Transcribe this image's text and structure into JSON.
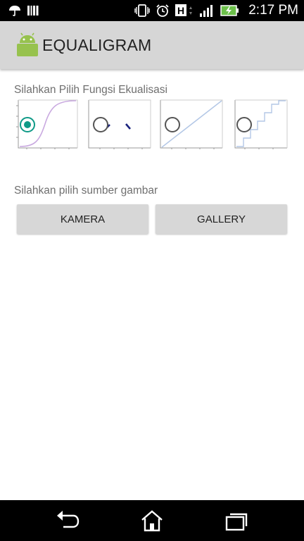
{
  "status_bar": {
    "time": "2:17 PM",
    "icons": [
      "umbrella-icon",
      "barcode-icon",
      "vibrate-icon",
      "alarm-icon",
      "h-signal-icon",
      "signal-bars-icon",
      "battery-charging-icon"
    ],
    "h_label": "H"
  },
  "action_bar": {
    "title": "EQUALIGRAM",
    "icon": "android-icon"
  },
  "content": {
    "function_label": "Silahkan Pilih Fungsi Ekualisasi",
    "function_options": [
      {
        "graph": "sigmoid-curve",
        "selected": true
      },
      {
        "graph": "scatter-points",
        "selected": false
      },
      {
        "graph": "linear-line",
        "selected": false
      },
      {
        "graph": "step-function",
        "selected": false
      }
    ],
    "source_label": "Silahkan pilih sumber gambar",
    "camera_button": "KAMERA",
    "gallery_button": "GALLERY"
  },
  "nav_bar": {
    "buttons": [
      "back-icon",
      "home-icon",
      "recent-apps-icon"
    ]
  },
  "colors": {
    "accent": "#0f9a87",
    "action_bar": "#d6d6d6",
    "button": "#d7d7d7"
  }
}
